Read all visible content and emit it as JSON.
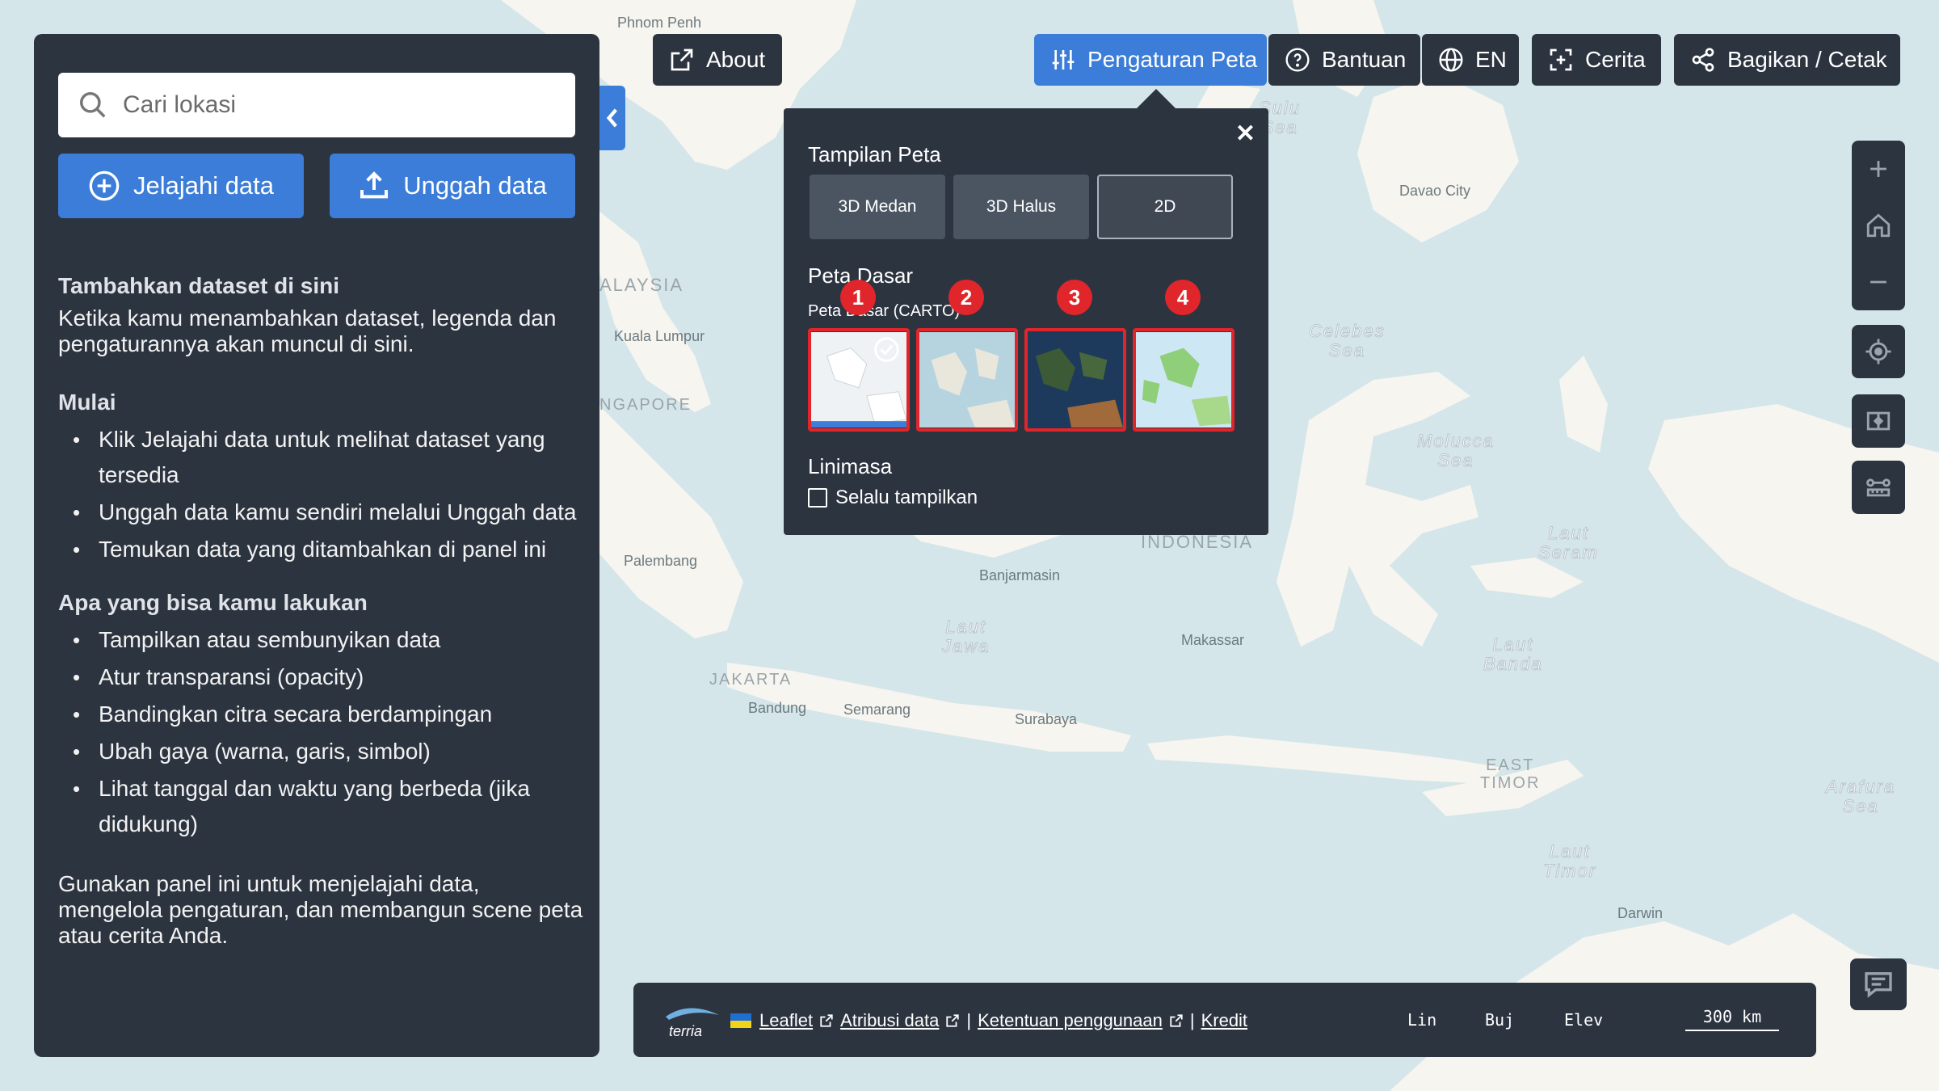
{
  "map": {
    "labels": {
      "phnom_penh": "Phnom Penh",
      "sulu_sea": "Sulu\nSea",
      "davao": "Davao City",
      "malaysia": "ALAYSIA",
      "kuala_lumpur": "Kuala Lumpur",
      "singapore": "NGAPORE",
      "celebes_sea": "Celebes\nSea",
      "molucca_sea": "Molucca\nSea",
      "indonesia": "INDONESIA",
      "palembang": "Palembang",
      "banjarmasin": "Banjarmasin",
      "laut_jawa": "Laut\nJawa",
      "makassar": "Makassar",
      "laut_seram": "Laut\nSeram",
      "laut_banda": "Laut\nBanda",
      "jakarta": "JAKARTA",
      "bandung": "Bandung",
      "semarang": "Semarang",
      "surabaya": "Surabaya",
      "east_timor": "EAST\nTIMOR",
      "arafura_sea": "Arafura\nSea",
      "laut_timor": "Laut\nTimor",
      "darwin": "Darwin"
    }
  },
  "sidebar": {
    "search_placeholder": "Cari lokasi",
    "explore_label": "Jelajahi data",
    "upload_label": "Unggah data",
    "add_heading": "Tambahkan dataset di sini",
    "add_text": "Ketika kamu menambahkan dataset, legenda dan pengaturannya akan muncul di sini.",
    "start_heading": "Mulai",
    "start_items": [
      "Klik Jelajahi data untuk melihat dataset yang tersedia",
      "Unggah data kamu sendiri melalui Unggah data",
      "Temukan data yang ditambahkan di panel ini"
    ],
    "can_do_heading": "Apa yang bisa kamu lakukan",
    "can_do_items": [
      "Tampilkan atau sembunyikan data",
      "Atur transparansi (opacity)",
      "Bandingkan citra secara berdampingan",
      "Ubah gaya (warna, garis, simbol)",
      "Lihat tanggal dan waktu yang berbeda (jika didukung)"
    ],
    "footer_text": "Gunakan panel ini untuk menjelajahi data, mengelola pengaturan, dan membangun scene peta atau cerita Anda."
  },
  "toolbar": {
    "about": "About",
    "map_settings": "Pengaturan Peta",
    "help": "Bantuan",
    "language": "EN",
    "story": "Cerita",
    "share": "Bagikan / Cetak"
  },
  "settings_popup": {
    "view_heading": "Tampilan Peta",
    "view_options": [
      "3D Medan",
      "3D Halus",
      "2D"
    ],
    "selected_view": "2D",
    "basemap_heading": "Peta Dasar",
    "basemap_caption": "Peta Dasar (CARTO)",
    "basemap_badges": [
      "1",
      "2",
      "3",
      "4"
    ],
    "timeline_heading": "Linimasa",
    "always_show_label": "Selalu tampilkan",
    "always_show_checked": false
  },
  "bottom_bar": {
    "leaflet": "Leaflet",
    "data_attribution": "Atribusi data",
    "terms": "Ketentuan penggunaan",
    "credits": "Kredit",
    "separator": "|",
    "lat_label": "Lin",
    "lon_label": "Buj",
    "elev_label": "Elev",
    "scale": "300 km"
  },
  "colors": {
    "panel": "#2c3440",
    "accent": "#3b7dd8",
    "badge": "#e0252b",
    "land": "#f7f5ef",
    "sea": "#d5e6eb"
  }
}
